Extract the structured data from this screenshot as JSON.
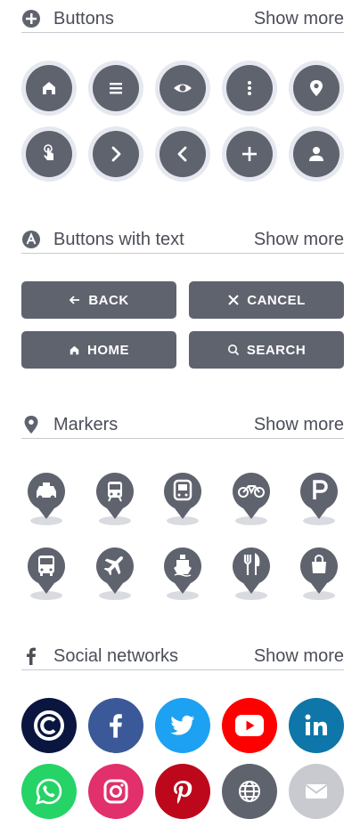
{
  "sections": {
    "buttons": {
      "title": "Buttons",
      "more": "Show more"
    },
    "buttons_text": {
      "title": "Buttons with text",
      "more": "Show more"
    },
    "markers": {
      "title": "Markers",
      "more": "Show more"
    },
    "social": {
      "title": "Social networks",
      "more": "Show more"
    }
  },
  "text_buttons": {
    "back": "BACK",
    "cancel": "CANCEL",
    "home": "HOME",
    "search": "SEARCH"
  },
  "icons": {
    "buttons": [
      "home-icon",
      "menu-icon",
      "eye-icon",
      "more-vertical-icon",
      "location-pin-icon",
      "tap-icon",
      "chevron-right-icon",
      "chevron-left-icon",
      "plus-icon",
      "user-icon"
    ],
    "markers": [
      "taxi-icon",
      "train-icon",
      "tram-icon",
      "bicycle-icon",
      "parking-icon",
      "bus-icon",
      "airplane-icon",
      "ferry-icon",
      "restaurant-icon",
      "shopping-bag-icon"
    ],
    "social": [
      "copyright-logo-icon",
      "facebook-icon",
      "twitter-icon",
      "youtube-icon",
      "linkedin-icon",
      "whatsapp-icon",
      "instagram-icon",
      "pinterest-icon",
      "globe-icon",
      "mail-icon"
    ]
  },
  "colors": {
    "button_dark": "#5f636e",
    "button_ring": "#e6e8f0",
    "facebook": "#3b5998",
    "twitter": "#1da1f2",
    "youtube": "#ff0000",
    "linkedin": "#0e76a8",
    "whatsapp": "#25d366",
    "instagram": "#e1306c",
    "pinterest": "#bd081c",
    "globe": "#5f636e",
    "mail": "#c8cad0",
    "copyright_logo": "#0a1640"
  }
}
